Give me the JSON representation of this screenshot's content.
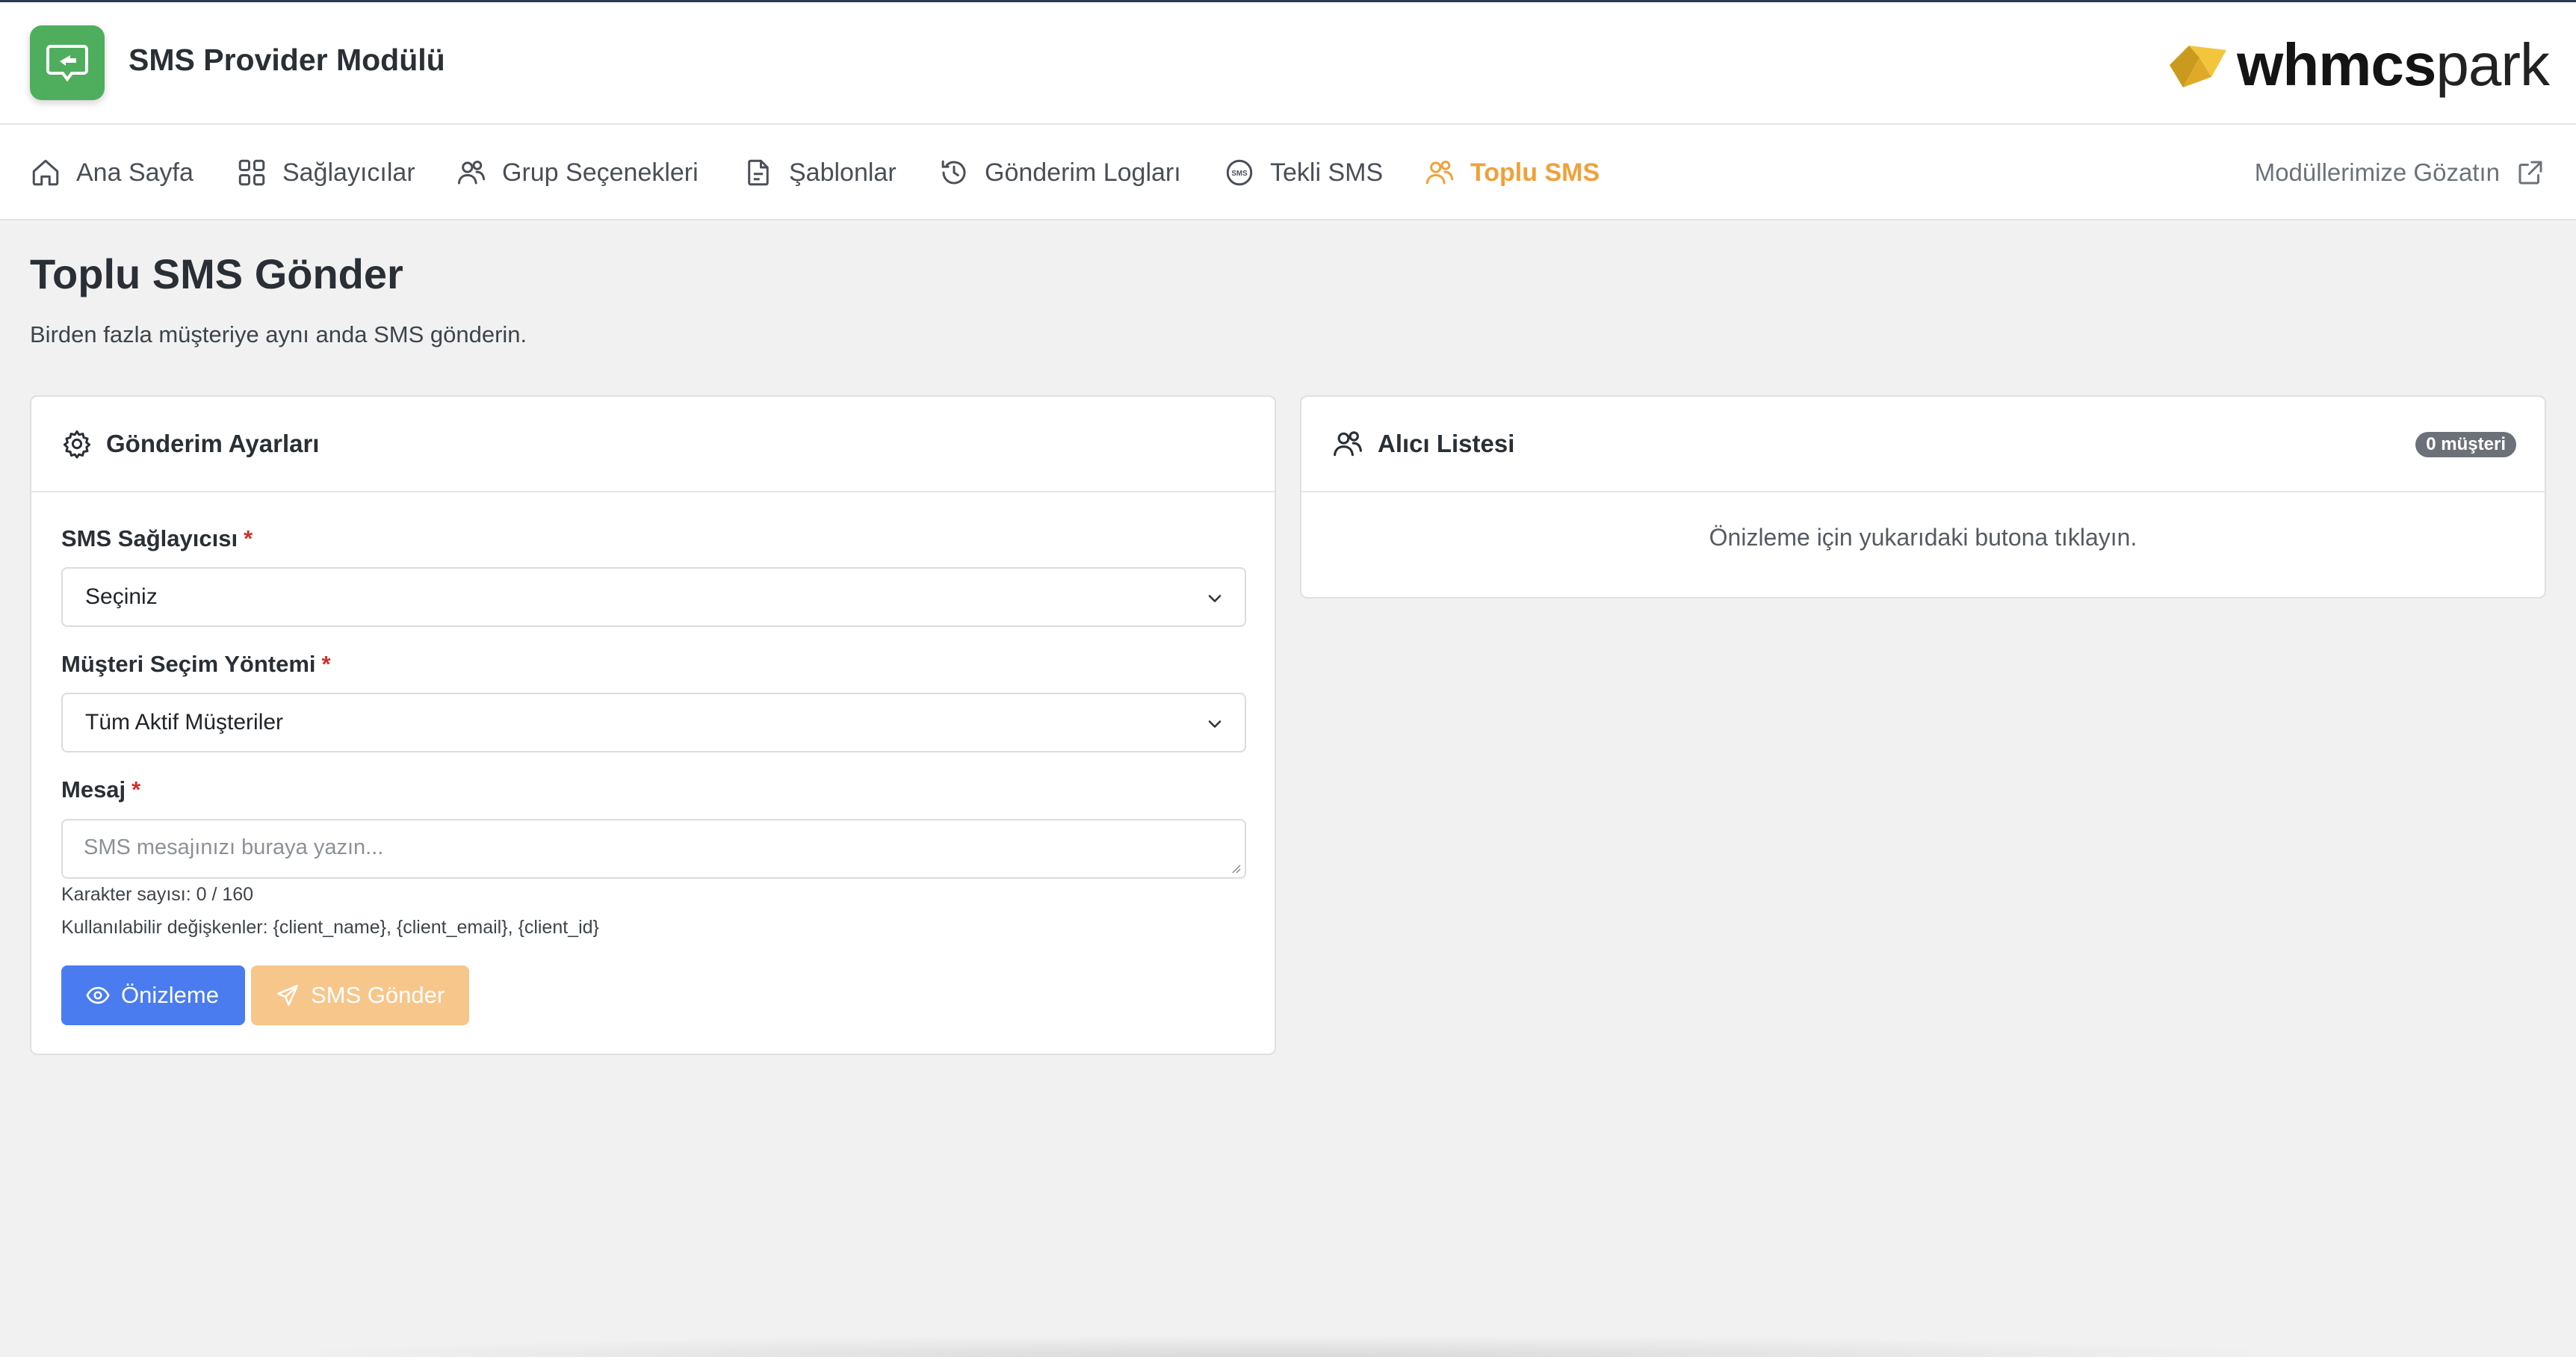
{
  "header": {
    "app_title": "SMS Provider Modülü",
    "brand_bold": "whmcs",
    "brand_light": "park",
    "brand_colors": {
      "accent": "#e9b52f",
      "green": "#4fae5d"
    }
  },
  "nav": {
    "items": [
      {
        "label": "Ana Sayfa",
        "icon": "home-icon"
      },
      {
        "label": "Sağlayıcılar",
        "icon": "grid-icon"
      },
      {
        "label": "Grup Seçenekleri",
        "icon": "users-icon"
      },
      {
        "label": "Şablonlar",
        "icon": "file-icon"
      },
      {
        "label": "Gönderim Logları",
        "icon": "history-icon"
      },
      {
        "label": "Tekli SMS",
        "icon": "sms-icon"
      },
      {
        "label": "Toplu SMS",
        "icon": "users-icon",
        "active": true
      }
    ],
    "external_link": "Modüllerimize Gözatın",
    "active_color": "#f0a13a"
  },
  "page": {
    "title": "Toplu SMS Gönder",
    "subtitle": "Birden fazla müşteriye aynı anda SMS gönderin."
  },
  "settings_card": {
    "title": "Gönderim Ayarları",
    "provider": {
      "label": "SMS Sağlayıcısı",
      "required": "*",
      "value": "Seçiniz"
    },
    "selection_method": {
      "label": "Müşteri Seçim Yöntemi",
      "required": "*",
      "value": "Tüm Aktif Müşteriler"
    },
    "message": {
      "label": "Mesaj",
      "required": "*",
      "placeholder": "SMS mesajınızı buraya yazın..."
    },
    "char_count": "Karakter sayısı: 0 / 160",
    "variables": "Kullanılabilir değişkenler: {client_name}, {client_email}, {client_id}",
    "preview_button": "Önizleme",
    "send_button": "SMS Gönder"
  },
  "recipients_card": {
    "title": "Alıcı Listesi",
    "badge": "0 müşteri",
    "empty_text": "Önizleme için yukarıdaki butona tıklayın."
  }
}
